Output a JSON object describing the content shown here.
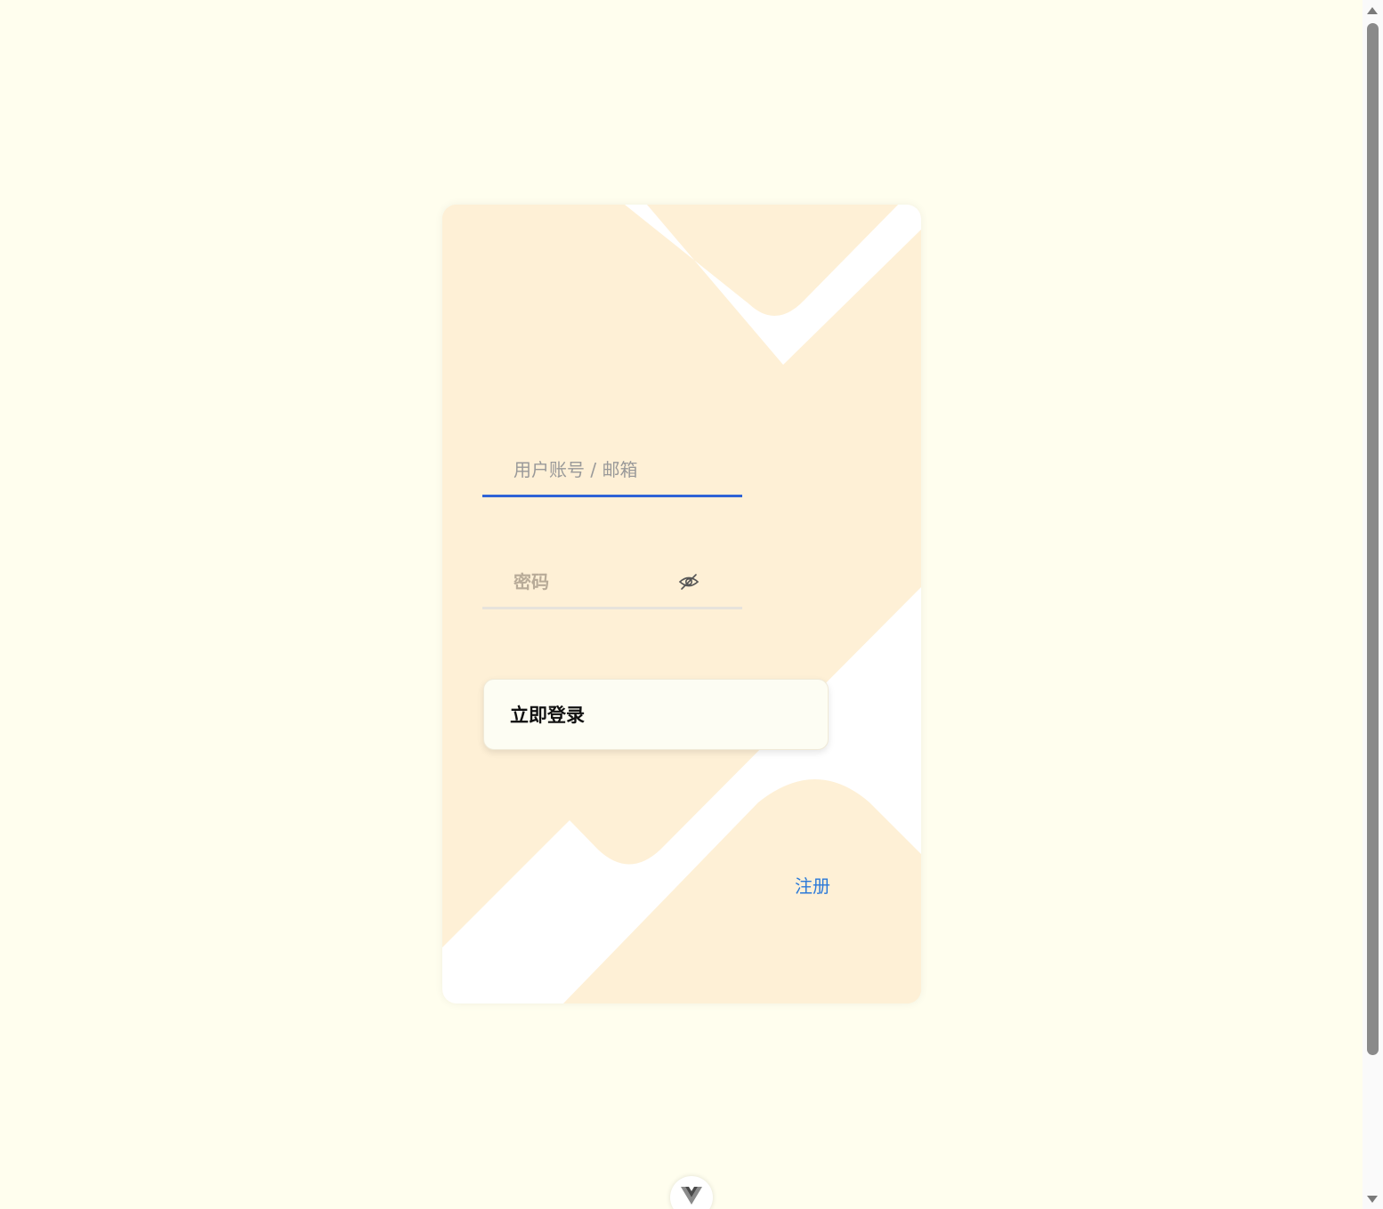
{
  "login_form": {
    "username_placeholder": "用户账号 / 邮箱",
    "password_placeholder": "密码",
    "login_button": "立即登录",
    "register_link": "注册"
  },
  "icons": {
    "password_toggle": "eye-slash-icon",
    "devtools": "vue-logo-icon"
  },
  "colors": {
    "page_background": "#fffeee",
    "card_background": "#fef0d6",
    "active_underline": "#2f63d6",
    "link": "#2b79d8"
  }
}
